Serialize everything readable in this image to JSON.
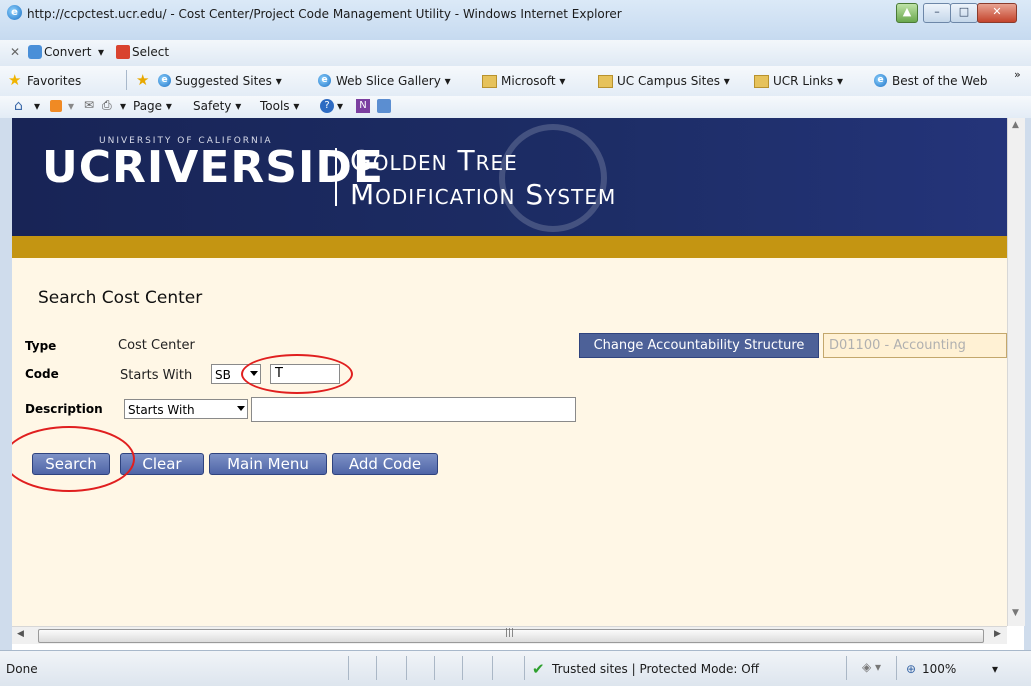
{
  "window": {
    "title": "http://ccpctest.ucr.edu/ - Cost Center/Project Code Management Utility - Windows Internet Explorer",
    "close_label": "✕"
  },
  "command_bar": {
    "convert_label": "Convert",
    "select_label": "Select"
  },
  "favorites_bar": {
    "favorites_label": "Favorites",
    "items": [
      {
        "label": "Suggested Sites ▾",
        "icon": "ie-icon"
      },
      {
        "label": "Web Slice Gallery ▾",
        "icon": "ie-icon"
      },
      {
        "label": "Microsoft ▾",
        "icon": "folder-icon"
      },
      {
        "label": "UC Campus Sites ▾",
        "icon": "folder-icon"
      },
      {
        "label": "UCR Links ▾",
        "icon": "folder-icon"
      },
      {
        "label": "Best of the Web",
        "icon": "ie-icon"
      }
    ],
    "overflow": "»"
  },
  "toolbar": {
    "page_label": "Page ▾",
    "safety_label": "Safety ▾",
    "tools_label": "Tools ▾"
  },
  "banner": {
    "ucr": "UCRIVERSIDE",
    "ucr_sub": "UNIVERSITY OF CALIFORNIA",
    "title_line1": "Golden Tree",
    "title_line2": "Modification System"
  },
  "page": {
    "title": "Search Cost Center",
    "type_label": "Type",
    "type_value": "Cost Center",
    "code_label": "Code",
    "code_operator": "Starts With",
    "code_prefix": "SB",
    "code_value": "T",
    "description_label": "Description",
    "description_operator": "Starts With",
    "description_value": "",
    "change_button": "Change Accountability Structure",
    "accountability_value": "D01100 - Accounting"
  },
  "buttons": {
    "search": "Search",
    "clear": "Clear",
    "main_menu": "Main Menu",
    "add_code": "Add Code"
  },
  "status": {
    "left": "Done",
    "zone": "Trusted sites | Protected Mode: Off",
    "zoom": "100%"
  },
  "colors": {
    "banner": "#1d2d66",
    "gold_band": "#c49512",
    "content_bg": "#fff7e6",
    "annotation": "#e01f1f"
  }
}
